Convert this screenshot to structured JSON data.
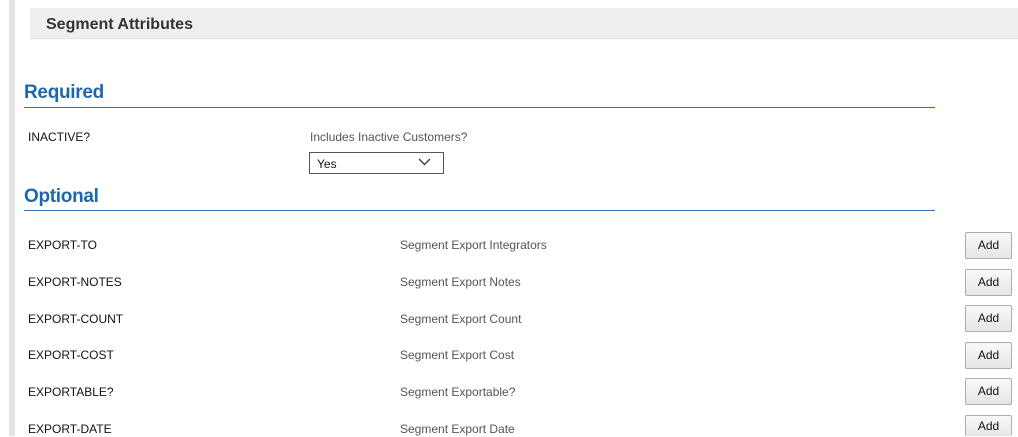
{
  "header": {
    "title": "Segment Attributes"
  },
  "required": {
    "title": "Required",
    "attribute": {
      "name": "INACTIVE?",
      "description": "Includes Inactive Customers?",
      "selected_value": "Yes"
    }
  },
  "optional": {
    "title": "Optional",
    "add_label": "Add",
    "rows": [
      {
        "name": "EXPORT-TO",
        "description": "Segment Export Integrators"
      },
      {
        "name": "EXPORT-NOTES",
        "description": "Segment Export Notes"
      },
      {
        "name": "EXPORT-COUNT",
        "description": "Segment Export Count"
      },
      {
        "name": "EXPORT-COST",
        "description": "Segment Export Cost"
      },
      {
        "name": "EXPORTABLE?",
        "description": "Segment Exportable?"
      },
      {
        "name": "EXPORT-DATE",
        "description": "Segment Export Date"
      }
    ]
  },
  "colors": {
    "section_title": "#1f67ad",
    "header_bg": "#efefef"
  }
}
